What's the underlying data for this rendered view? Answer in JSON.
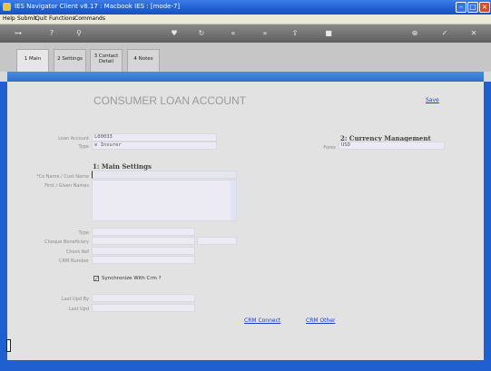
{
  "window": {
    "title": "IES Navigator Client v8.17 : Macbook IES :      [mode-7]"
  },
  "menu": [
    "Help",
    "Submit",
    "Quit",
    "Functions",
    "Commands"
  ],
  "tabs": [
    {
      "label": "1 Main"
    },
    {
      "label": "2 Settings"
    },
    {
      "label": "3 Contact Detail"
    },
    {
      "label": "4 Notes"
    }
  ],
  "header": {
    "title": "CONSUMER LOAN ACCOUNT",
    "save_label": "Save"
  },
  "account": {
    "loan_account_label": "Loan Account",
    "loan_account_value": "L00033",
    "type_label": "Type",
    "type_value": "e Insurer"
  },
  "currency": {
    "section_title": "2: Currency Management",
    "forex_label": "Forex",
    "forex_value": "USD"
  },
  "main_settings": {
    "section_title": "1: Main Settings",
    "surname_label": "*Co Name / Cust Name",
    "first_names_label": "First / Given Names",
    "type_label": "Type",
    "cheque_label": "Cheque Beneficiary",
    "check_ref_label": "Check Ref",
    "crm_number_label": "CRM Number",
    "sync_label": "Synchronize With Crm ?",
    "last_upd_by_label": "Last Upd By",
    "last_upd_label": "Last Upd"
  },
  "links": {
    "crm_connect": "CRM Connect",
    "crm_other": "CRM Other"
  },
  "colors": {
    "titlebar": "#1f5fd0",
    "link": "#1a3fc4",
    "field": "#ecebf3"
  }
}
